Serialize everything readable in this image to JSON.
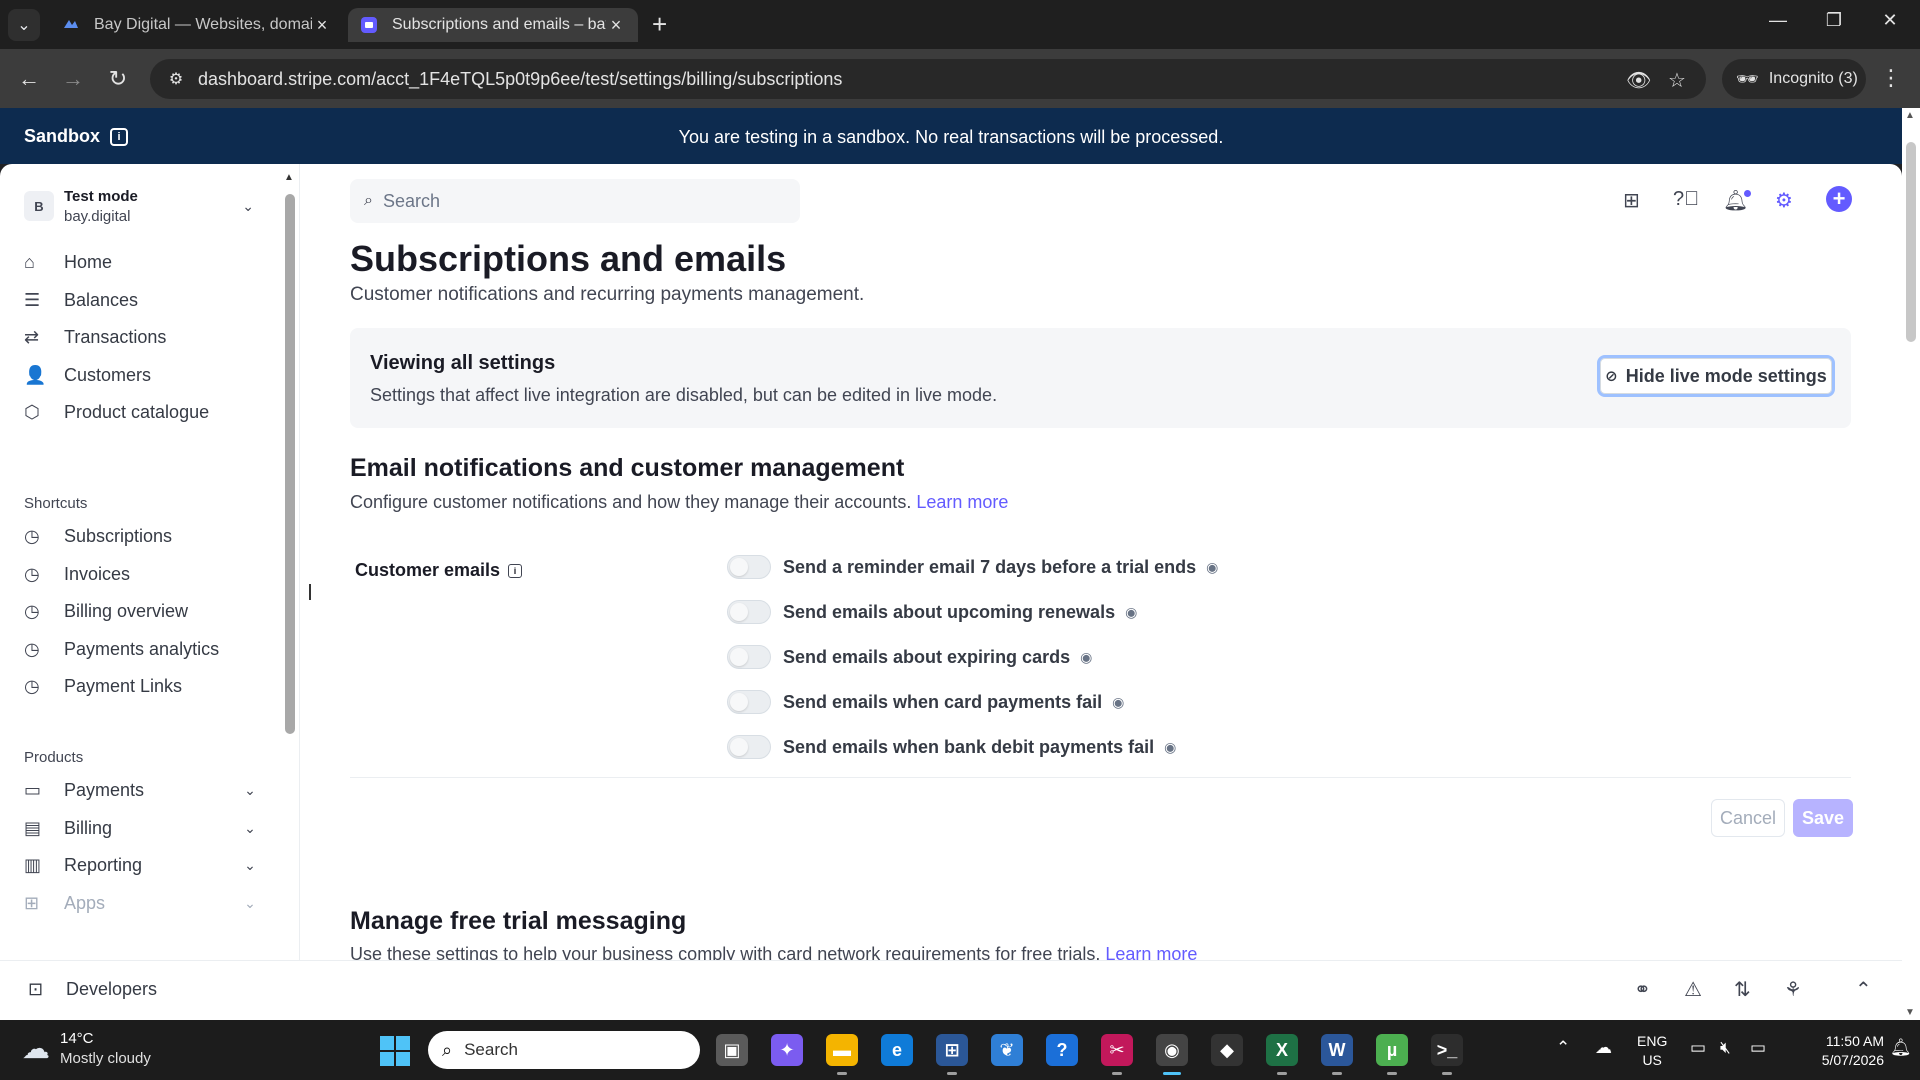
{
  "browser": {
    "tabs": [
      {
        "label": "Bay Digital — Websites, domain"
      },
      {
        "label": "Subscriptions and emails – bay.digital"
      }
    ],
    "url": "dashboard.stripe.com/acct_1F4eTQL5p0t9p6ee/test/settings/billing/subscriptions",
    "incognito_label": "Incognito (3)"
  },
  "sandbox_banner": {
    "label": "Sandbox",
    "message": "You are testing in a sandbox. No real transactions will be processed."
  },
  "account": {
    "avatar_letter": "B",
    "mode": "Test mode",
    "domain": "bay.digital"
  },
  "sidebar": {
    "main_items": [
      {
        "label": "Home",
        "icon": "home-icon"
      },
      {
        "label": "Balances",
        "icon": "balances-icon"
      },
      {
        "label": "Transactions",
        "icon": "transactions-icon"
      },
      {
        "label": "Customers",
        "icon": "customers-icon"
      },
      {
        "label": "Product catalogue",
        "icon": "package-icon"
      }
    ],
    "shortcuts_heading": "Shortcuts",
    "shortcuts": [
      {
        "label": "Subscriptions"
      },
      {
        "label": "Invoices"
      },
      {
        "label": "Billing overview"
      },
      {
        "label": "Payments analytics"
      },
      {
        "label": "Payment Links"
      }
    ],
    "products_heading": "Products",
    "products": [
      {
        "label": "Payments"
      },
      {
        "label": "Billing"
      },
      {
        "label": "Reporting"
      },
      {
        "label": "Apps"
      }
    ],
    "developers_label": "Developers"
  },
  "header": {
    "search_placeholder": "Search"
  },
  "page": {
    "title": "Subscriptions and emails",
    "subtitle": "Customer notifications and recurring payments management."
  },
  "settings_banner": {
    "title": "Viewing all settings",
    "description": "Settings that affect live integration are disabled, but can be edited in live mode.",
    "button_label": "Hide live mode settings"
  },
  "email_section": {
    "title": "Email notifications and customer management",
    "description": "Configure customer notifications and how they manage their accounts.",
    "learn_more": "Learn more",
    "customer_emails_label": "Customer emails",
    "options": [
      {
        "label": "Send a reminder email 7 days before a trial ends",
        "enabled": false
      },
      {
        "label": "Send emails about upcoming renewals",
        "enabled": false
      },
      {
        "label": "Send emails about expiring cards",
        "enabled": false
      },
      {
        "label": "Send emails when card payments fail",
        "enabled": false
      },
      {
        "label": "Send emails when bank debit payments fail",
        "enabled": false
      }
    ],
    "cancel_label": "Cancel",
    "save_label": "Save"
  },
  "trial_section": {
    "title": "Manage free trial messaging",
    "description": "Use these settings to help your business comply with card network requirements for free trials.",
    "learn_more": "Learn more"
  },
  "taskbar": {
    "weather_temp": "14°C",
    "weather_condition": "Mostly cloudy",
    "search_label": "Search",
    "lang_top": "ENG",
    "lang_bottom": "US",
    "time": "11:50 AM",
    "date": "5/07/2026"
  },
  "colors": {
    "accent": "#635bff",
    "sandbox_banner": "#0d2b4f"
  }
}
